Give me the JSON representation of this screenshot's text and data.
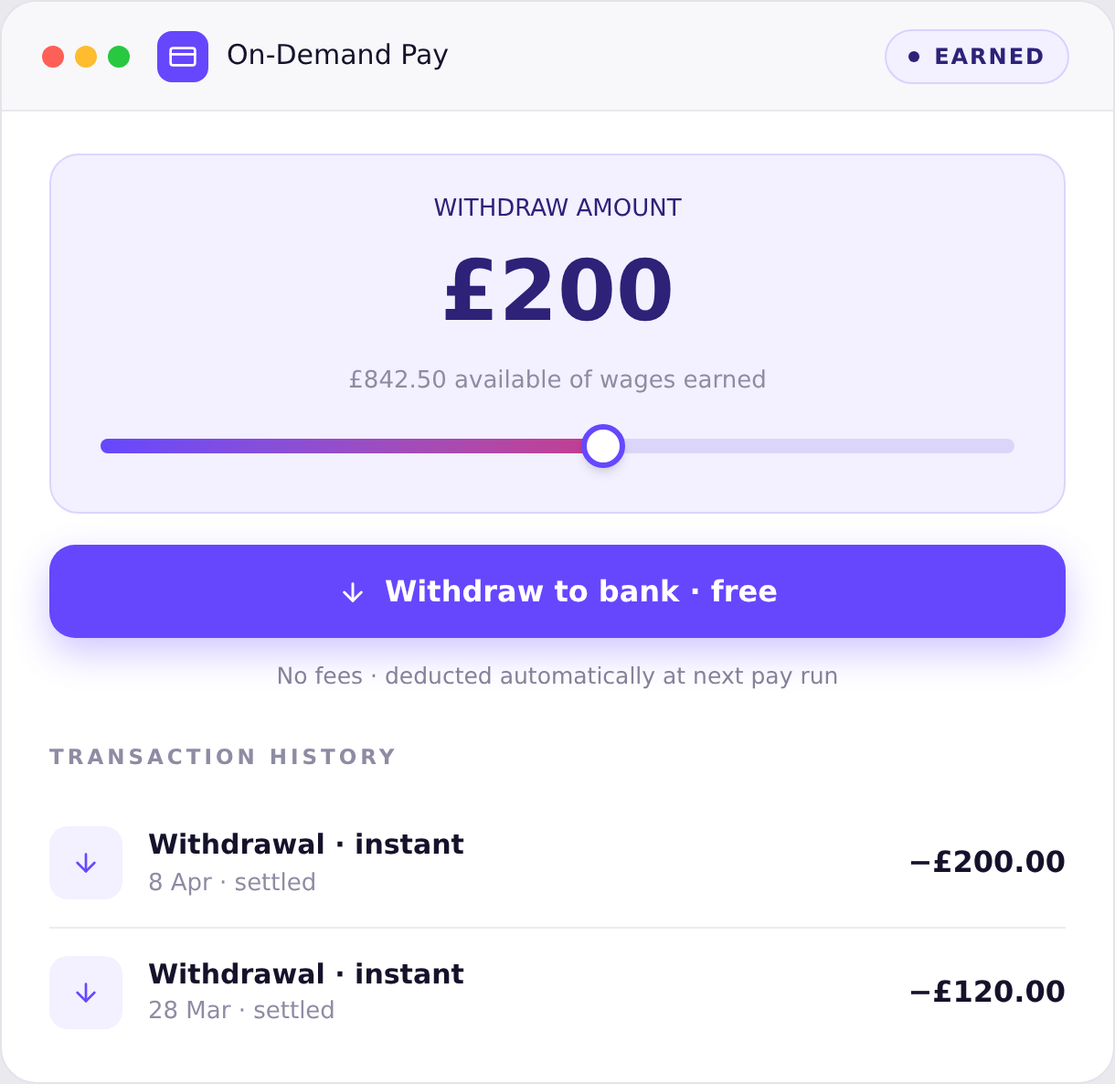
{
  "window": {
    "title": "On-Demand Pay",
    "badge": "EARNED"
  },
  "withdraw": {
    "label": "WITHDRAW AMOUNT",
    "amount": "£200",
    "available": "£842.50 available of wages earned",
    "level": 0.55
  },
  "button": {
    "label": "Withdraw to bank · free"
  },
  "note": "No fees · deducted automatically at next pay run",
  "history": {
    "title": "TRANSACTION HISTORY",
    "rows": [
      {
        "title": "Withdrawal · instant",
        "subtitle": "8 Apr · settled",
        "amount": "−£200.00"
      },
      {
        "title": "Withdrawal · instant",
        "subtitle": "28 Mar · settled",
        "amount": "−£120.00"
      }
    ]
  }
}
